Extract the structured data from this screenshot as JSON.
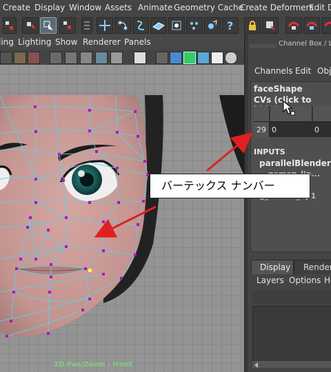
{
  "menubar": {
    "items": [
      "Create",
      "Display",
      "Window",
      "Assets",
      "Animate",
      "Geometry Cache",
      "Create Deformers",
      "Edit De"
    ]
  },
  "viewport": {
    "menu": [
      "ling",
      "Lighting",
      "Show",
      "Renderer",
      "Panels"
    ],
    "status": "2D Pan/Zoom : front"
  },
  "channel_box": {
    "title": "Channel Box / La",
    "menu": [
      "Channels",
      "Edit",
      "Obje"
    ],
    "object": "faceShape",
    "cvs_label": "CVs (click to hide)",
    "cv_row": {
      "index": "29",
      "values": [
        "0",
        "0"
      ]
    },
    "inputs_label": "INPUTS",
    "inputs": [
      "parallelBlender",
      "...gemen_lin...",
      "...",
      "g_corner_up1"
    ]
  },
  "lower_panel": {
    "tabs": [
      "Display",
      "Render"
    ],
    "menu": [
      "Layers",
      "Options",
      "He"
    ]
  },
  "callout": {
    "text": "バーテックス ナンバー"
  },
  "colors": {
    "wire": "#5fd0e0",
    "vertex": "#c000c0",
    "selected_vertex": "#ffff40",
    "arrow": "#e02020"
  }
}
